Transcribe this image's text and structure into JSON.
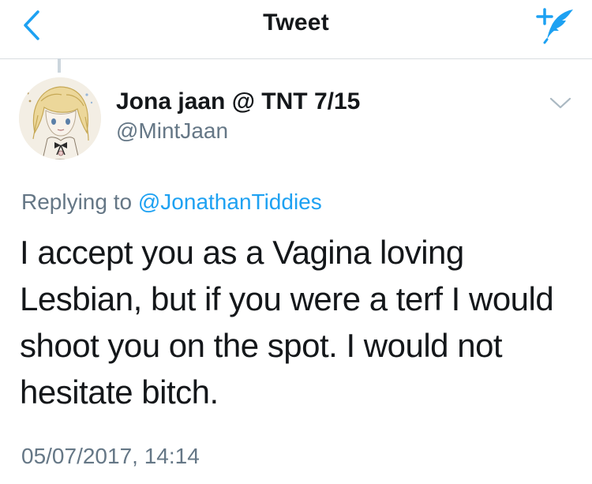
{
  "navbar": {
    "title": "Tweet",
    "back_icon": "chevron-left-icon",
    "compose_icon": "compose-tweet-icon"
  },
  "tweet": {
    "author_name": "Jona jaan @ TNT 7/15",
    "author_handle": "@MintJaan",
    "avatar_icon": "avatar-illustration",
    "more_icon": "chevron-down-icon",
    "replying_prefix": "Replying to",
    "replying_to": "@JonathanTiddies",
    "text": "I accept you as a Vagina loving Lesbian, but if you were a terf I would shoot you on the spot. I would not hesitate bitch.",
    "timestamp": "05/07/2017, 14:14"
  },
  "colors": {
    "accent": "#1da1f2",
    "text_primary": "#14171a",
    "text_secondary": "#657786",
    "divider": "#d8dde1"
  }
}
